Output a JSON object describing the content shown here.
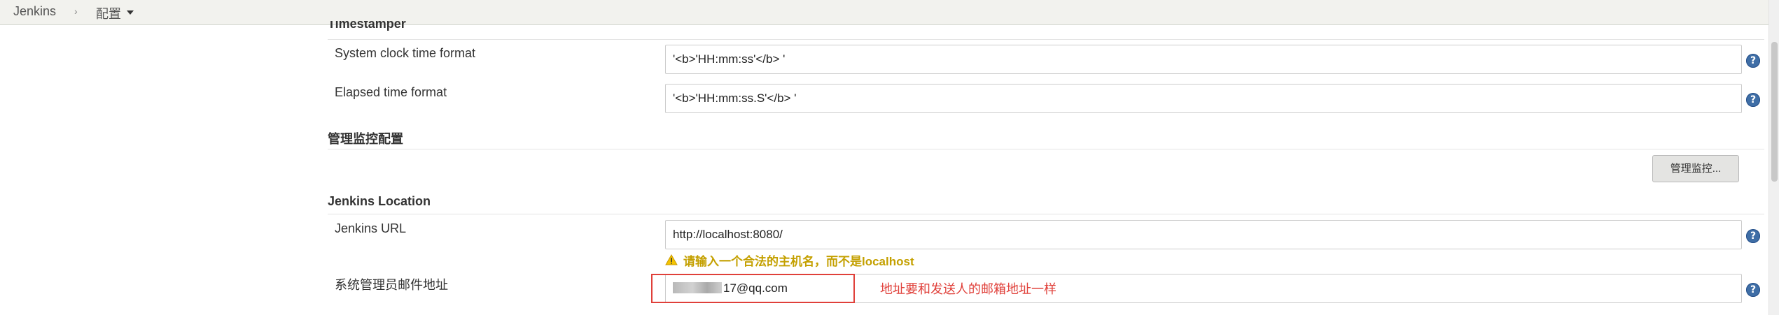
{
  "breadcrumb": {
    "root": "Jenkins",
    "separator": "›",
    "current": "配置"
  },
  "sections": {
    "timestamper": {
      "title": "Timestamper",
      "system_clock_label": "System clock time format",
      "system_clock_value": "'<b>'HH:mm:ss'</b> '",
      "elapsed_label": "Elapsed time format",
      "elapsed_value": "'<b>'HH:mm:ss.S'</b> '"
    },
    "monitoring": {
      "title": "管理监控配置",
      "button_label": "管理监控..."
    },
    "location": {
      "title": "Jenkins Location",
      "url_label": "Jenkins URL",
      "url_value": "http://localhost:8080/",
      "warning_text": "请输入一个合法的主机名，而不是localhost",
      "admin_email_label": "系统管理员邮件地址",
      "admin_email_value_visible": "17@qq.com",
      "annotation": "地址要和发送人的邮箱地址一样"
    }
  },
  "help_icon_glyph": "?",
  "colors": {
    "warning": "#c4a000",
    "annotation_red": "#e0403a",
    "help_blue": "#3f6ea6"
  }
}
